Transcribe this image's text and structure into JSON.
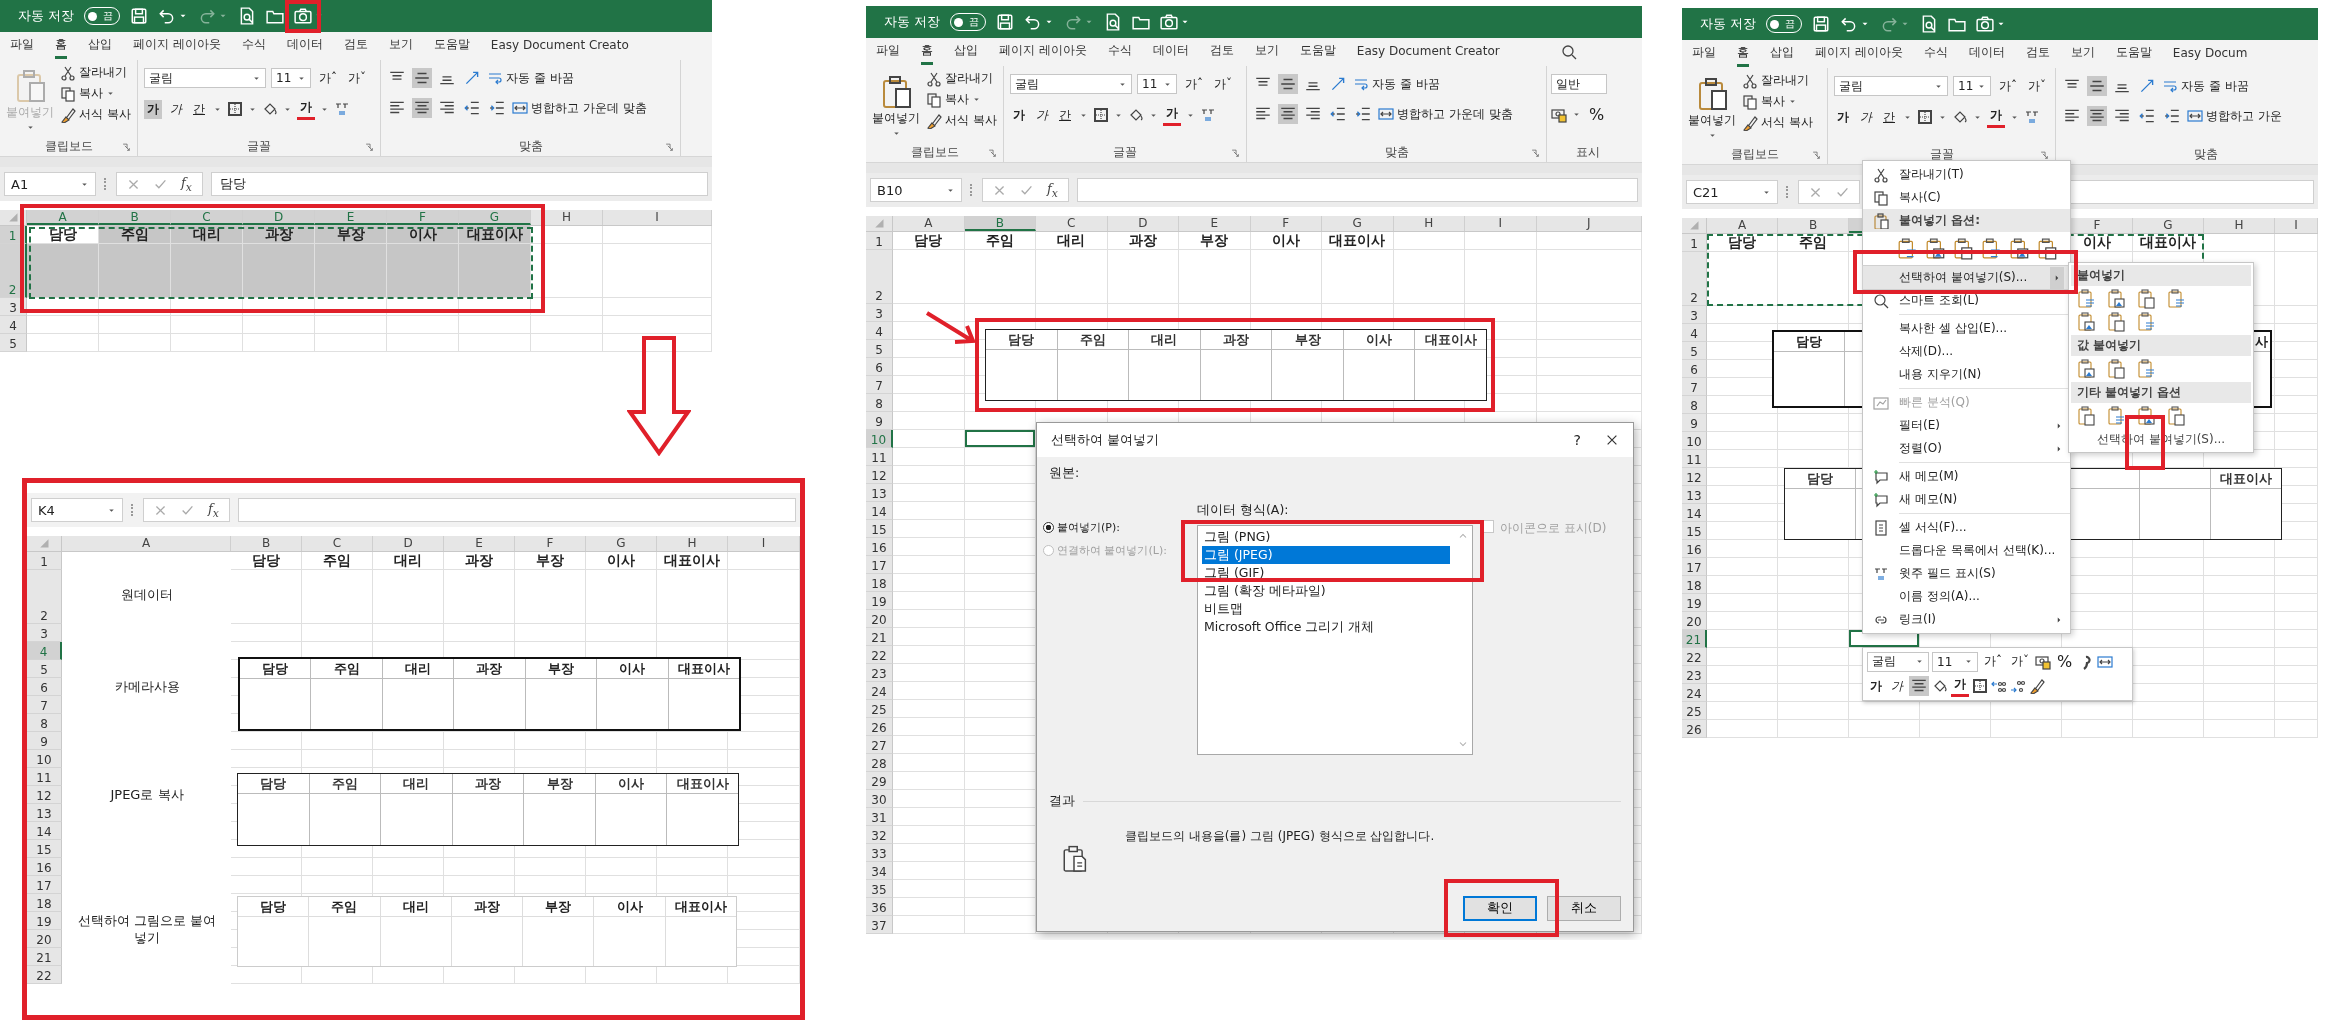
{
  "windows": [
    {
      "autosave": "자동 저장",
      "autosave_state": "끔",
      "autosave_on": false,
      "tabs": [
        {
          "label": "파일",
          "selected": false
        },
        {
          "label": "홈",
          "selected": true
        },
        {
          "label": "삽입",
          "selected": false
        },
        {
          "label": "페이지 레이아웃",
          "selected": false
        },
        {
          "label": "수식",
          "selected": false
        },
        {
          "label": "데이터",
          "selected": false
        },
        {
          "label": "검토",
          "selected": false
        },
        {
          "label": "보기",
          "selected": false
        },
        {
          "label": "도움말",
          "selected": false
        },
        {
          "label": "Easy Document Creato",
          "selected": false
        }
      ],
      "ribbon": {
        "paste": "붙여넣기",
        "paste_enabled": false,
        "cut": "잘라내기",
        "copy": "복사",
        "format_painter": "서식 복사",
        "clipboard_group": "클립보드",
        "font_name": "굴림",
        "font_size": "11",
        "grow": "가ˆ",
        "shrink": "가ˇ",
        "bold": "가",
        "bold_selected": true,
        "italic": "가",
        "underline": "간",
        "font_color": "가",
        "font_group": "글꼴",
        "wrap_text": "자동 줄 바꿈",
        "merge": "병합하고 가운데 맞춤",
        "alignment_group": "맞춤",
        "valign_middle": true,
        "halign_center": true
      },
      "name_box": "A1",
      "fx": "f$_{x}$",
      "formula": "담당",
      "copy_marquee": true,
      "columns": [
        {
          "label": "A",
          "selected": true
        },
        {
          "label": "B",
          "selected": true
        },
        {
          "label": "C",
          "selected": true
        },
        {
          "label": "D",
          "selected": true
        },
        {
          "label": "E",
          "selected": true
        },
        {
          "label": "F",
          "selected": true
        },
        {
          "label": "G",
          "selected": true
        },
        {
          "label": "H",
          "selected": false
        },
        {
          "label": "I",
          "selected": false
        }
      ],
      "rows": [
        {
          "label": "1",
          "selected": true,
          "cells": [
            {
              "text": "담당"
            },
            {
              "text": "주임"
            },
            {
              "text": "대리"
            },
            {
              "text": "과장"
            },
            {
              "text": "부장"
            },
            {
              "text": "이사"
            },
            {
              "text": "대표이사"
            }
          ]
        },
        {
          "label": "2",
          "selected": true
        },
        {
          "label": "3",
          "selected": false
        },
        {
          "label": "4",
          "selected": false
        },
        {
          "label": "5",
          "selected": false
        }
      ]
    },
    {
      "autosave": "자동 저장",
      "autosave_state": "끔",
      "autosave_on": false,
      "tabs": [
        {
          "label": "파일",
          "selected": false
        },
        {
          "label": "홈",
          "selected": true
        },
        {
          "label": "삽입",
          "selected": false
        },
        {
          "label": "페이지 레이아웃",
          "selected": false
        },
        {
          "label": "수식",
          "selected": false
        },
        {
          "label": "데이터",
          "selected": false
        },
        {
          "label": "검토",
          "selected": false
        },
        {
          "label": "보기",
          "selected": false
        },
        {
          "label": "도움말",
          "selected": false
        },
        {
          "label": "Easy Document Creator",
          "selected": false
        }
      ],
      "ribbon": {
        "paste": "붙여넣기",
        "paste_enabled": true,
        "cut": "잘라내기",
        "copy": "복사",
        "format_painter": "서식 복사",
        "clipboard_group": "클립보드",
        "font_name": "굴림",
        "font_size": "11",
        "grow": "가ˆ",
        "shrink": "가ˇ",
        "bold": "가",
        "bold_selected": false,
        "italic": "가",
        "underline": "간",
        "font_color": "가",
        "font_group": "글꼴",
        "wrap_text": "자동 줄 바꿈",
        "merge": "병합하고 가운데 맞춤",
        "alignment_group": "맞춤",
        "valign_middle": true,
        "halign_center": true,
        "number_format": "일반",
        "percent": "%",
        "number_group": "표시"
      },
      "name_box": "B10",
      "fx": "f$_{x}$",
      "columns": [
        {
          "label": "A",
          "selected": false
        },
        {
          "label": "B",
          "selected": true
        },
        {
          "label": "C",
          "selected": false
        },
        {
          "label": "D",
          "selected": false
        },
        {
          "label": "E",
          "selected": false
        },
        {
          "label": "F",
          "selected": false
        },
        {
          "label": "G",
          "selected": false
        },
        {
          "label": "H",
          "selected": false
        },
        {
          "label": "I",
          "selected": false
        },
        {
          "label": "J",
          "selected": false
        }
      ],
      "rows": [
        {
          "label": "1",
          "selected": false,
          "cells": [
            {
              "text": "담당"
            },
            {
              "text": "주임"
            },
            {
              "text": "대리"
            },
            {
              "text": "과장"
            },
            {
              "text": "부장"
            },
            {
              "text": "이사"
            },
            {
              "text": "대표이사"
            }
          ]
        },
        {
          "label": "2",
          "selected": false
        },
        {
          "label": "3",
          "selected": false
        },
        {
          "label": "4",
          "selected": false
        },
        {
          "label": "5",
          "selected": false
        },
        {
          "label": "6",
          "selected": false
        },
        {
          "label": "7",
          "selected": false
        },
        {
          "label": "8",
          "selected": false
        },
        {
          "label": "9",
          "selected": false
        },
        {
          "label": "10",
          "selected": true
        },
        {
          "label": "11",
          "selected": false
        },
        {
          "label": "12",
          "selected": false
        },
        {
          "label": "13",
          "selected": false
        },
        {
          "label": "14",
          "selected": false
        },
        {
          "label": "15",
          "selected": false
        },
        {
          "label": "16",
          "selected": false
        },
        {
          "label": "17",
          "selected": false
        },
        {
          "label": "18",
          "selected": false
        },
        {
          "label": "19",
          "selected": false
        },
        {
          "label": "20",
          "selected": false
        },
        {
          "label": "21",
          "selected": false
        },
        {
          "label": "22",
          "selected": false
        },
        {
          "label": "23",
          "selected": false
        },
        {
          "label": "24",
          "selected": false
        },
        {
          "label": "25",
          "selected": false
        },
        {
          "label": "26",
          "selected": false
        },
        {
          "label": "27",
          "selected": false
        },
        {
          "label": "28",
          "selected": false
        },
        {
          "label": "29",
          "selected": false
        },
        {
          "label": "30",
          "selected": false
        },
        {
          "label": "31",
          "selected": false
        },
        {
          "label": "32",
          "selected": false
        },
        {
          "label": "33",
          "selected": false
        },
        {
          "label": "34",
          "selected": false
        },
        {
          "label": "35",
          "selected": false
        },
        {
          "label": "36",
          "selected": false
        },
        {
          "label": "37",
          "selected": false
        }
      ],
      "pictures": [
        {
          "kind": "jpeg",
          "cells": [
            {
              "text": "담당"
            },
            {
              "text": "주임"
            },
            {
              "text": "대리"
            },
            {
              "text": "과장"
            },
            {
              "text": "부장"
            },
            {
              "text": "이사"
            },
            {
              "text": "대표이사"
            }
          ]
        }
      ],
      "dialog": {
        "title": "선택하여 붙여넣기",
        "help": "?",
        "source_label": "원본:",
        "options": [
          {
            "label": "붙여넣기(P):",
            "selected": true,
            "disabled": false
          },
          {
            "label": "연결하여 붙여넣기(L):",
            "selected": false,
            "disabled": true
          }
        ],
        "format_label": "데이터 형식(A):",
        "formats": [
          {
            "label": "그림 (PNG)",
            "selected": false
          },
          {
            "label": "그림 (JPEG)",
            "selected": true
          },
          {
            "label": "그림 (GIF)",
            "selected": false
          },
          {
            "label": "그림 (확장 메타파일)",
            "selected": false
          },
          {
            "label": "비트맵",
            "selected": false
          },
          {
            "label": "Microsoft Office 그리기 개체",
            "selected": false
          }
        ],
        "display_as_icon": {
          "label": "아이콘으로 표시(D)",
          "checked": false,
          "disabled": true
        },
        "result_label": "결과",
        "result_text": "클립보드의 내용을(를) 그림 (JPEG) 형식으로 삽입합니다.",
        "buttons": [
          {
            "label": "확인",
            "default": true
          },
          {
            "label": "취소",
            "default": false
          }
        ]
      }
    },
    {
      "autosave": "자동 저장",
      "autosave_state": "끔",
      "autosave_on": false,
      "tabs": [
        {
          "label": "파일",
          "selected": false
        },
        {
          "label": "홈",
          "selected": true
        },
        {
          "label": "삽입",
          "selected": false
        },
        {
          "label": "페이지 레이아웃",
          "selected": false
        },
        {
          "label": "수식",
          "selected": false
        },
        {
          "label": "데이터",
          "selected": false
        },
        {
          "label": "검토",
          "selected": false
        },
        {
          "label": "보기",
          "selected": false
        },
        {
          "label": "도움말",
          "selected": false
        },
        {
          "label": "Easy Docum",
          "selected": false
        }
      ],
      "ribbon": {
        "paste": "붙여넣기",
        "paste_enabled": true,
        "cut": "잘라내기",
        "copy": "복사",
        "format_painter": "서식 복사",
        "clipboard_group": "클립보드",
        "font_name": "굴림",
        "font_size": "11",
        "grow": "가ˆ",
        "shrink": "가ˇ",
        "bold": "가",
        "bold_selected": false,
        "italic": "가",
        "underline": "간",
        "font_color": "가",
        "font_group": "글꼴",
        "wrap_text": "자동 줄 바꿈",
        "merge": "병합하고 가운",
        "alignment_group": "맞춤",
        "valign_middle": true,
        "halign_center": true
      },
      "name_box": "C21",
      "copy_marquee": true,
      "columns": [
        {
          "label": "A",
          "selected": false
        },
        {
          "label": "B",
          "selected": false
        },
        {
          "selected": true
        },
        {},
        {},
        {
          "label": "F",
          "selected": false
        },
        {
          "label": "G",
          "selected": false
        },
        {
          "label": "H",
          "selected": false
        },
        {
          "label": "I",
          "selected": false
        }
      ],
      "rows": [
        {
          "label": "1",
          "selected": false,
          "cells": [
            {
              "text": "담당"
            },
            {
              "text": "주임"
            },
            {},
            {},
            {},
            {
              "text": "이사"
            },
            {
              "text": "대표이사"
            }
          ]
        },
        {
          "label": "2",
          "selected": false
        },
        {
          "label": "3",
          "selected": false
        },
        {
          "label": "4",
          "selected": false
        },
        {
          "label": "5",
          "selected": false
        },
        {
          "label": "6",
          "selected": false
        },
        {
          "label": "7",
          "selected": false
        },
        {
          "label": "8",
          "selected": false
        },
        {
          "label": "9",
          "selected": false
        },
        {
          "label": "10",
          "selected": false
        },
        {
          "label": "11",
          "selected": false
        },
        {
          "label": "12",
          "selected": false
        },
        {
          "label": "13",
          "selected": false
        },
        {
          "label": "14",
          "selected": false
        },
        {
          "label": "15",
          "selected": false
        },
        {
          "label": "16",
          "selected": false
        },
        {
          "label": "17",
          "selected": false
        },
        {
          "label": "18",
          "selected": false
        },
        {
          "label": "19",
          "selected": false
        },
        {
          "label": "20",
          "selected": false
        },
        {
          "label": "21",
          "selected": true
        },
        {
          "label": "22",
          "selected": false
        },
        {
          "label": "23",
          "selected": false
        },
        {
          "label": "24",
          "selected": false
        },
        {
          "label": "25",
          "selected": false
        },
        {
          "label": "26",
          "selected": false
        }
      ],
      "pictures": [
        {
          "kind": "camera",
          "cells": [
            {
              "text": "담당"
            },
            {},
            {},
            {},
            {},
            {},
            {
              "text": "사"
            }
          ]
        },
        {
          "kind": "jpeg",
          "cells": [
            {
              "text": "담당"
            },
            {},
            {},
            {},
            {},
            {},
            {
              "text": "대표이사"
            }
          ]
        }
      ],
      "context_menu": {
        "items": [
          {
            "kind": "item",
            "label": "잘라내기(T)",
            "selected": false,
            "disabled": false,
            "submenu": false
          },
          {
            "kind": "item",
            "label": "복사(C)",
            "selected": false,
            "disabled": false,
            "submenu": false
          },
          {
            "kind": "header",
            "label": "붙여넣기 옵션:"
          },
          {
            "kind": "paste-icons"
          },
          {
            "kind": "item",
            "label": "선택하여 붙여넣기(S)...",
            "selected": true,
            "disabled": false,
            "submenu": true
          },
          {
            "kind": "item",
            "label": "스마트 조회(L)",
            "selected": false,
            "disabled": false,
            "submenu": false
          },
          {
            "kind": "separator"
          },
          {
            "kind": "item",
            "label": "복사한 셀 삽입(E)...",
            "selected": false,
            "disabled": false,
            "submenu": false
          },
          {
            "kind": "item",
            "label": "삭제(D)...",
            "selected": false,
            "disabled": false,
            "submenu": false
          },
          {
            "kind": "item",
            "label": "내용 지우기(N)",
            "selected": false,
            "disabled": false,
            "submenu": false
          },
          {
            "kind": "separator"
          },
          {
            "kind": "item",
            "label": "빠른 분석(Q)",
            "selected": false,
            "disabled": true,
            "submenu": false
          },
          {
            "kind": "item",
            "label": "필터(E)",
            "selected": false,
            "disabled": false,
            "submenu": true
          },
          {
            "kind": "item",
            "label": "정렬(O)",
            "selected": false,
            "disabled": false,
            "submenu": true
          },
          {
            "kind": "separator"
          },
          {
            "kind": "item",
            "label": "새 메모(M)",
            "selected": false,
            "disabled": false,
            "submenu": false
          },
          {
            "kind": "item",
            "label": "새 메모(N)",
            "selected": false,
            "disabled": false,
            "submenu": false
          },
          {
            "kind": "separator"
          },
          {
            "kind": "item",
            "label": "셀 서식(F)...",
            "selected": false,
            "disabled": false,
            "submenu": false
          },
          {
            "kind": "item",
            "label": "드롭다운 목록에서 선택(K)...",
            "selected": false,
            "disabled": false,
            "submenu": false
          },
          {
            "kind": "item",
            "label": "윗주 필드 표시(S)",
            "selected": false,
            "disabled": false,
            "submenu": false
          },
          {
            "kind": "item",
            "label": "이름 정의(A)...",
            "selected": false,
            "disabled": false,
            "submenu": false
          },
          {
            "kind": "item",
            "label": "링크(I)",
            "selected": false,
            "disabled": false,
            "submenu": true
          }
        ]
      },
      "submenu": {
        "sections": [
          {
            "title": "붙여넣기"
          },
          {
            "title": "값 붙여넣기"
          },
          {
            "title": "기타 붙여넣기 옵션"
          }
        ],
        "footer": "선택하여 붙여넣기(S)..."
      },
      "mini_toolbar": {
        "font_name": "굴림",
        "font_size": "11",
        "grow": "가ˆ",
        "shrink": "가ˇ",
        "percent": "%",
        "bold": "가",
        "italic": "가",
        "center_selected": true,
        "font_color": "가"
      }
    }
  ],
  "lower_sheet": {
    "name_box": "K4",
    "fx": "f$_{x}$",
    "columns": [
      {
        "label": "A",
        "selected": false
      },
      {
        "label": "B",
        "selected": false
      },
      {
        "label": "C",
        "selected": false
      },
      {
        "label": "D",
        "selected": false
      },
      {
        "label": "E",
        "selected": false
      },
      {
        "label": "F",
        "selected": false
      },
      {
        "label": "G",
        "selected": false
      },
      {
        "label": "H",
        "selected": false
      },
      {
        "label": "I",
        "selected": false
      }
    ],
    "rows": [
      {
        "label": "1",
        "selected": false,
        "cells": [
          {},
          {
            "text": "담당"
          },
          {
            "text": "주임"
          },
          {
            "text": "대리"
          },
          {
            "text": "과장"
          },
          {
            "text": "부장"
          },
          {
            "text": "이사"
          },
          {
            "text": "대표이사"
          }
        ]
      },
      {
        "label": "2",
        "selected": false,
        "cells": [
          {
            "text": "원데이터"
          }
        ]
      },
      {
        "label": "3",
        "selected": false
      },
      {
        "label": "4",
        "selected": true
      },
      {
        "label": "5",
        "selected": false
      },
      {
        "label": "6",
        "selected": false,
        "cells": [
          {
            "text": "카메라사용"
          }
        ]
      },
      {
        "label": "7",
        "selected": false
      },
      {
        "label": "8",
        "selected": false
      },
      {
        "label": "9",
        "selected": false
      },
      {
        "label": "10",
        "selected": false
      },
      {
        "label": "11",
        "selected": false
      },
      {
        "label": "12",
        "selected": false,
        "cells": [
          {
            "text": "JPEG로 복사"
          }
        ]
      },
      {
        "label": "13",
        "selected": false
      },
      {
        "label": "14",
        "selected": false
      },
      {
        "label": "15",
        "selected": false
      },
      {
        "label": "16",
        "selected": false
      },
      {
        "label": "17",
        "selected": false
      },
      {
        "label": "18",
        "selected": false
      },
      {
        "label": "19",
        "selected": false,
        "cells": [
          {
            "text": "선택하여 그림으로 붙여넣기"
          }
        ]
      },
      {
        "label": "20",
        "selected": false
      },
      {
        "label": "21",
        "selected": false
      },
      {
        "label": "22",
        "selected": false
      }
    ],
    "pictures": [
      {
        "kind": "camera",
        "cells": [
          {
            "text": "담당"
          },
          {
            "text": "주임"
          },
          {
            "text": "대리"
          },
          {
            "text": "과장"
          },
          {
            "text": "부장"
          },
          {
            "text": "이사"
          },
          {
            "text": "대표이사"
          }
        ]
      },
      {
        "kind": "jpeg",
        "cells": [
          {
            "text": "담당"
          },
          {
            "text": "주임"
          },
          {
            "text": "대리"
          },
          {
            "text": "과장"
          },
          {
            "text": "부장"
          },
          {
            "text": "이사"
          },
          {
            "text": "대표이사"
          }
        ]
      },
      {
        "kind": "image",
        "cells": [
          {
            "text": "담당"
          },
          {
            "text": "주임"
          },
          {
            "text": "대리"
          },
          {
            "text": "과장"
          },
          {
            "text": "부장"
          },
          {
            "text": "이사"
          },
          {
            "text": "대표이사"
          }
        ]
      }
    ]
  }
}
